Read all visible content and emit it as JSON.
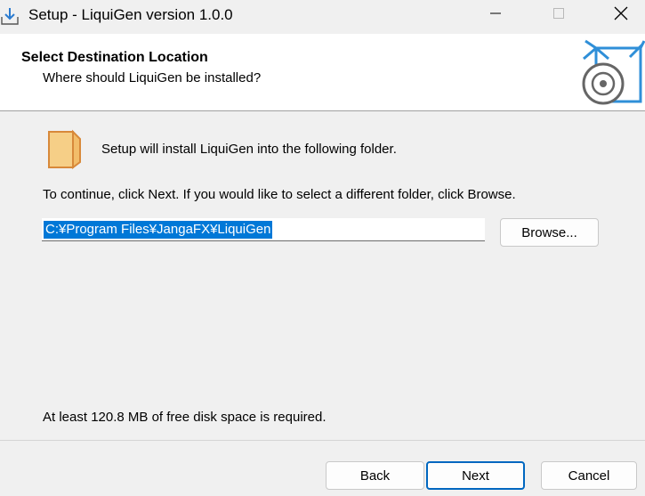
{
  "window": {
    "title": "Setup - LiquiGen version 1.0.0",
    "icons": {
      "app": "setup-download-icon",
      "minimize": "minimize-icon",
      "maximize": "maximize-icon",
      "close": "close-icon"
    }
  },
  "header": {
    "title": "Select Destination Location",
    "subtitle": "Where should LiquiGen be installed?",
    "image_icon": "box-disc-icon",
    "accent_color": "#2f8fd8"
  },
  "body": {
    "folder_icon": "folder-icon",
    "install_text": "Setup will install LiquiGen into the following folder.",
    "continue_text": "To continue, click Next. If you would like to select a different folder, click Browse.",
    "path_value": "C:¥Program Files¥JangaFX¥LiquiGen",
    "browse_label": "Browse...",
    "disk_space_text": "At least 120.8 MB of free disk space is required.",
    "selection_color": "#0078d7"
  },
  "footer": {
    "back_label": "Back",
    "next_label": "Next",
    "cancel_label": "Cancel"
  }
}
